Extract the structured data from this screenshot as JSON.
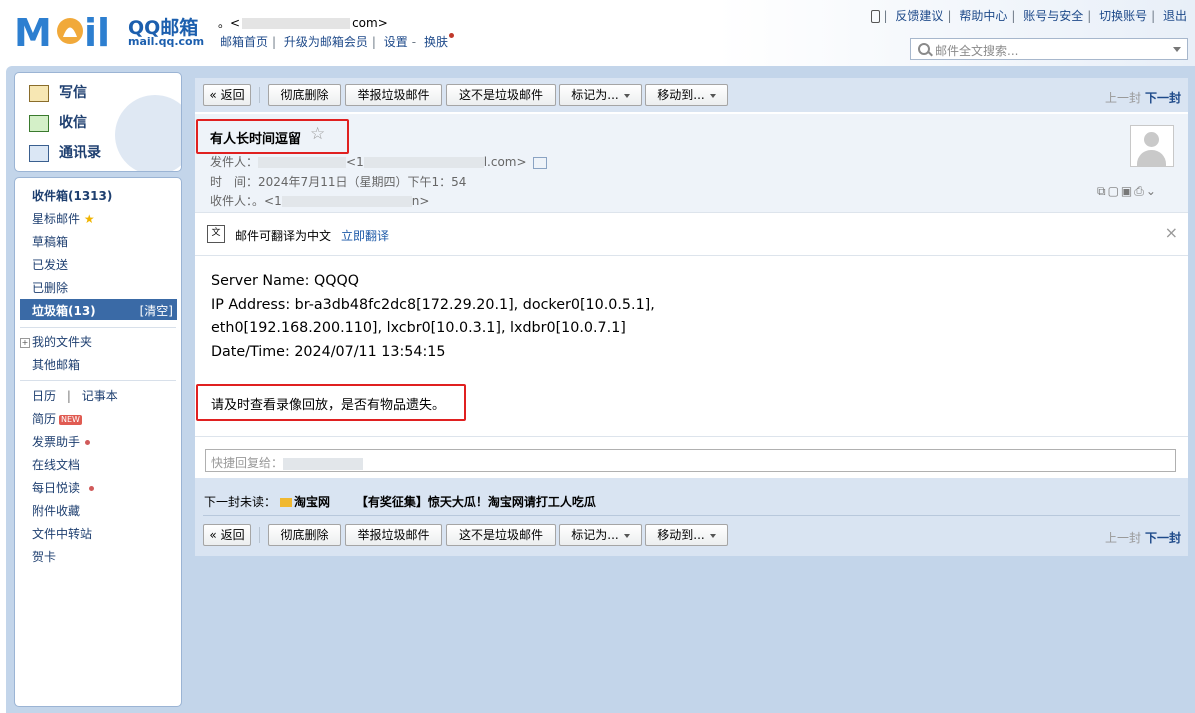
{
  "header": {
    "logo_text": "MOil",
    "logo_title": "QQ邮箱",
    "logo_domain": "mail.qq.com",
    "account_prefix": "。<",
    "account_suffix": "com>",
    "links": [
      "邮箱首页",
      "升级为邮箱会员",
      "设置",
      "换肤"
    ],
    "right_links": [
      "反馈建议",
      "帮助中心",
      "账号与安全",
      "切换账号",
      "退出"
    ],
    "search_placeholder": "邮件全文搜索..."
  },
  "sidebar": {
    "quick": [
      {
        "label": "写信",
        "icon": "pencil-icon"
      },
      {
        "label": "收信",
        "icon": "inbox-download-icon"
      },
      {
        "label": "通讯录",
        "icon": "contacts-icon"
      }
    ],
    "folders": {
      "inbox": "收件箱(1313)",
      "starred": "星标邮件",
      "drafts": "草稿箱",
      "sent": "已发送",
      "deleted": "已删除",
      "spam": "垃圾箱(13)",
      "spam_clear": "[清空]",
      "my_folders": "我的文件夹",
      "other_mailboxes": "其他邮箱",
      "calendar": "日历",
      "notepad": "记事本",
      "resume": "简历",
      "resume_badge": "NEW",
      "invoice": "发票助手",
      "docs": "在线文档",
      "daily": "每日悦读",
      "attachments": "附件收藏",
      "transfer": "文件中转站",
      "cards": "贺卡"
    }
  },
  "toolbar": {
    "back": "« 返回",
    "delete": "彻底删除",
    "report_spam": "举报垃圾邮件",
    "not_spam": "这不是垃圾邮件",
    "mark_as": "标记为...",
    "move_to": "移动到...",
    "prev": "上一封",
    "next": "下一封"
  },
  "mail": {
    "subject": "有人长时间逗留",
    "from_label": "发件人：",
    "from_mid": "<1",
    "from_suffix": "l.com>",
    "time_label": "时　间：",
    "time_value": "2024年7月11日（星期四）下午1：54",
    "to_label": "收件人：",
    "to_prefix": "。<1",
    "to_suffix": "n>",
    "translate_text": "邮件可翻译为中文",
    "translate_link": "立即翻译",
    "body_lines": [
      "Server Name: QQQQ",
      "IP Address: br-a3db48fc2dc8[172.29.20.1], docker0[10.0.5.1],",
      "eth0[192.168.200.110], lxcbr0[10.0.3.1], lxdbr0[10.0.7.1]",
      "Date/Time: 2024/07/11 13:54:15"
    ],
    "body_note": "请及时查看录像回放，是否有物品遗失。"
  },
  "reply": {
    "placeholder": "快捷回复给："
  },
  "next_unread": {
    "label": "下一封未读：",
    "sender": "淘宝网",
    "subject": "【有奖征集】惊天大瓜！淘宝网请打工人吃瓜"
  }
}
